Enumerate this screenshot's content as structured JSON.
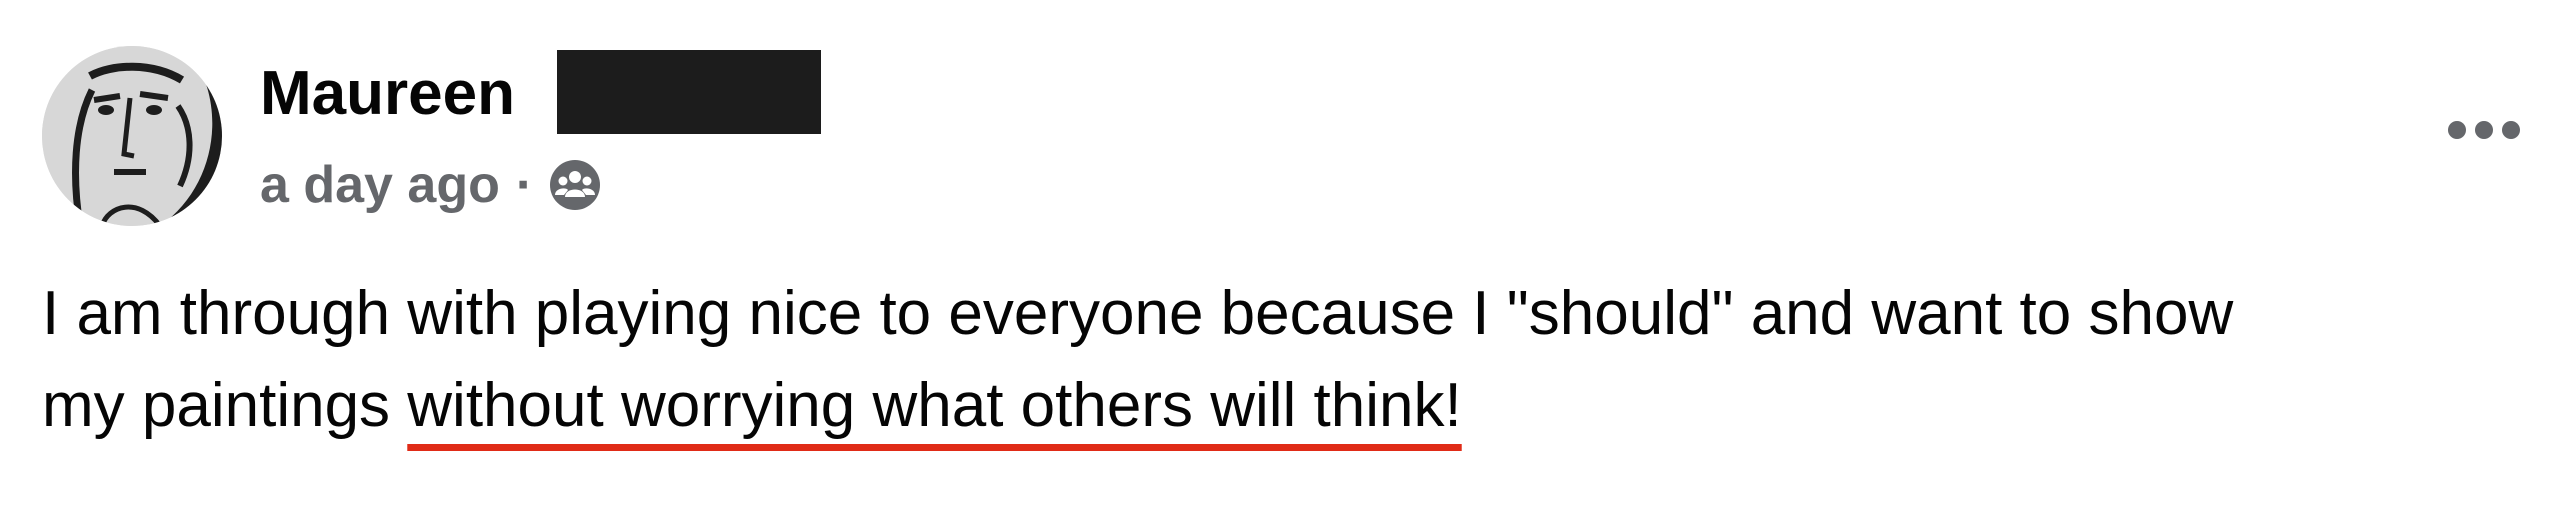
{
  "post": {
    "author": {
      "name": "Maureen",
      "surname_redacted": true,
      "avatar_icon": "face-line-art-avatar"
    },
    "meta": {
      "timestamp": "a day ago",
      "separator": "·",
      "audience_icon": "group-audience-icon"
    },
    "more_options_icon": "more-horizontal-icon",
    "body": {
      "line1": "I am through with playing nice to everyone because I \"should\" and want to show",
      "line2_plain": "my paintings ",
      "line2_highlighted": "without worrying what others will think!"
    },
    "annotation": {
      "underline_color": "#e02b17"
    }
  }
}
